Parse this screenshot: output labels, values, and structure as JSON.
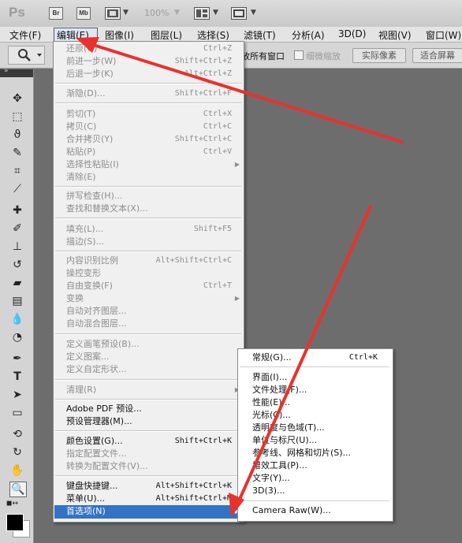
{
  "appbar": {
    "logo": "Ps",
    "br_label": "Br",
    "mb_label": "Mb",
    "zoom": "100%"
  },
  "menubar": [
    {
      "label": "文件(F)"
    },
    {
      "label": "编辑(E)"
    },
    {
      "label": "图像(I)"
    },
    {
      "label": "图层(L)"
    },
    {
      "label": "选择(S)"
    },
    {
      "label": "滤镜(T)"
    },
    {
      "label": "分析(A)"
    },
    {
      "label": "3D(D)"
    },
    {
      "label": "视图(V)"
    },
    {
      "label": "窗口(W)"
    }
  ],
  "optbar": {
    "fit_all": "放所有窗口",
    "scrubby_zoom": "细微缩放",
    "actual_pixels": "实际像素",
    "fit_screen": "适合屏幕"
  },
  "edit_menu": [
    {
      "label": "还原(O)",
      "shortcut": "Ctrl+Z"
    },
    {
      "label": "前进一步(W)",
      "shortcut": "Shift+Ctrl+Z"
    },
    {
      "label": "后退一步(K)",
      "shortcut": "Alt+Ctrl+Z"
    },
    {
      "label": "渐隐(D)...",
      "shortcut": "Shift+Ctrl+F"
    },
    {
      "label": "剪切(T)",
      "shortcut": "Ctrl+X"
    },
    {
      "label": "拷贝(C)",
      "shortcut": "Ctrl+C"
    },
    {
      "label": "合并拷贝(Y)",
      "shortcut": "Shift+Ctrl+C"
    },
    {
      "label": "粘贴(P)",
      "shortcut": "Ctrl+V"
    },
    {
      "label": "选择性粘贴(I)",
      "shortcut": ""
    },
    {
      "label": "清除(E)",
      "shortcut": ""
    },
    {
      "label": "拼写检查(H)...",
      "shortcut": ""
    },
    {
      "label": "查找和替换文本(X)...",
      "shortcut": ""
    },
    {
      "label": "填充(L)...",
      "shortcut": "Shift+F5"
    },
    {
      "label": "描边(S)...",
      "shortcut": ""
    },
    {
      "label": "内容识别比例",
      "shortcut": "Alt+Shift+Ctrl+C"
    },
    {
      "label": "操控变形",
      "shortcut": ""
    },
    {
      "label": "自由变换(F)",
      "shortcut": "Ctrl+T"
    },
    {
      "label": "变换",
      "shortcut": ""
    },
    {
      "label": "自动对齐图层...",
      "shortcut": ""
    },
    {
      "label": "自动混合图层...",
      "shortcut": ""
    },
    {
      "label": "定义画笔预设(B)...",
      "shortcut": ""
    },
    {
      "label": "定义图案...",
      "shortcut": ""
    },
    {
      "label": "定义自定形状...",
      "shortcut": ""
    },
    {
      "label": "清理(R)",
      "shortcut": ""
    },
    {
      "label": "Adobe PDF 预设...",
      "shortcut": ""
    },
    {
      "label": "预设管理器(M)...",
      "shortcut": ""
    },
    {
      "label": "颜色设置(G)...",
      "shortcut": "Shift+Ctrl+K"
    },
    {
      "label": "指定配置文件...",
      "shortcut": ""
    },
    {
      "label": "转换为配置文件(V)...",
      "shortcut": ""
    },
    {
      "label": "键盘快捷键...",
      "shortcut": "Alt+Shift+Ctrl+K"
    },
    {
      "label": "菜单(U)...",
      "shortcut": "Alt+Shift+Ctrl+M"
    },
    {
      "label": "首选项(N)",
      "shortcut": ""
    }
  ],
  "preferences_submenu": [
    {
      "label": "常规(G)...",
      "shortcut": "Ctrl+K"
    },
    {
      "label": "界面(I)...",
      "shortcut": ""
    },
    {
      "label": "文件处理(F)...",
      "shortcut": ""
    },
    {
      "label": "性能(E)...",
      "shortcut": ""
    },
    {
      "label": "光标(C)...",
      "shortcut": ""
    },
    {
      "label": "透明度与色域(T)...",
      "shortcut": ""
    },
    {
      "label": "单位与标尺(U)...",
      "shortcut": ""
    },
    {
      "label": "参考线、网格和切片(S)...",
      "shortcut": ""
    },
    {
      "label": "增效工具(P)...",
      "shortcut": ""
    },
    {
      "label": "文字(Y)...",
      "shortcut": ""
    },
    {
      "label": "3D(3)...",
      "shortcut": ""
    },
    {
      "label": "Camera Raw(W)...",
      "shortcut": ""
    }
  ],
  "colors": {
    "highlight": "#3373c6",
    "annotation_arrow": "#e8322d"
  }
}
